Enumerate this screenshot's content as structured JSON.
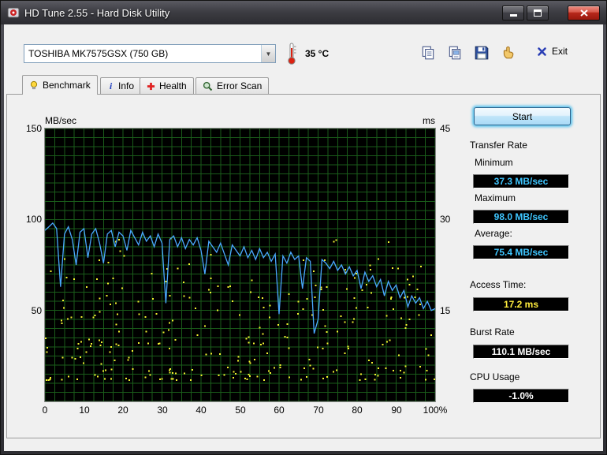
{
  "window": {
    "title": "HD Tune 2.55 - Hard Disk Utility"
  },
  "toolbar": {
    "drive_select": "TOSHIBA MK7575GSX (750 GB)",
    "temperature": "35 °C",
    "exit_label": "Exit"
  },
  "tabs": [
    {
      "label": "Benchmark",
      "active": true
    },
    {
      "label": "Info",
      "active": false
    },
    {
      "label": "Health",
      "active": false
    },
    {
      "label": "Error Scan",
      "active": false
    }
  ],
  "panel": {
    "start_button": "Start",
    "transfer_rate": {
      "heading": "Transfer Rate",
      "minimum_label": "Minimum",
      "minimum_value": "37.3 MB/sec",
      "maximum_label": "Maximum",
      "maximum_value": "98.0 MB/sec",
      "average_label": "Average:",
      "average_value": "75.4 MB/sec"
    },
    "access_time_label": "Access Time:",
    "access_time_value": "17.2 ms",
    "burst_rate_label": "Burst Rate",
    "burst_rate_value": "110.1 MB/sec",
    "cpu_usage_label": "CPU Usage",
    "cpu_usage_value": "-1.0%"
  },
  "colors": {
    "transfer_line": "#4aa8ff",
    "access_dots": "#f2f230",
    "grid": "#1a5c1a",
    "value_cyan": "#3fc6ff",
    "value_yellow": "#ffec3d",
    "value_white": "#ffffff",
    "plot_background": "#000000",
    "client_background": "#f0f0f0"
  },
  "chart_data": {
    "type": "line",
    "title": "HD Tune benchmark: transfer rate over disk position with access-time scatter",
    "y_left": {
      "label": "MB/sec",
      "range": [
        0,
        150
      ],
      "ticks": [
        150,
        100,
        50
      ]
    },
    "y_right": {
      "label": "ms",
      "range": [
        0,
        45
      ],
      "ticks": [
        45,
        30,
        15
      ]
    },
    "x_ticks": [
      "0",
      "10",
      "20",
      "30",
      "40",
      "50",
      "60",
      "70",
      "80",
      "90",
      "100%"
    ],
    "grid_color": "#1a5c1a",
    "series": [
      {
        "name": "transfer-rate-mbsec",
        "color": "#4aa8ff",
        "x_start": 0,
        "x_step": 1,
        "values": [
          94,
          96,
          98,
          95,
          63,
          92,
          96,
          89,
          75,
          93,
          95,
          79,
          92,
          95,
          87,
          76,
          92,
          94,
          85,
          93,
          91,
          83,
          94,
          90,
          86,
          93,
          88,
          91,
          85,
          92,
          87,
          54,
          89,
          91,
          85,
          90,
          84,
          89,
          86,
          90,
          83,
          70,
          88,
          85,
          82,
          87,
          81,
          75,
          86,
          83,
          80,
          85,
          79,
          83,
          78,
          84,
          79,
          82,
          77,
          81,
          48,
          80,
          76,
          82,
          78,
          80,
          62,
          79,
          77,
          37.3,
          45,
          78,
          76,
          73,
          77,
          72,
          75,
          70,
          74,
          69,
          72,
          62,
          71,
          66,
          69,
          63,
          67,
          58,
          66,
          61,
          64,
          57,
          61,
          52,
          58,
          54,
          57,
          51,
          55,
          50,
          51
        ]
      }
    ],
    "scatter": {
      "name": "access-time-ms",
      "color": "#f2f230",
      "seed": 7,
      "count": 340,
      "ms_low": 3.5,
      "ms_spread": 20,
      "high_fraction": 0.12
    }
  }
}
